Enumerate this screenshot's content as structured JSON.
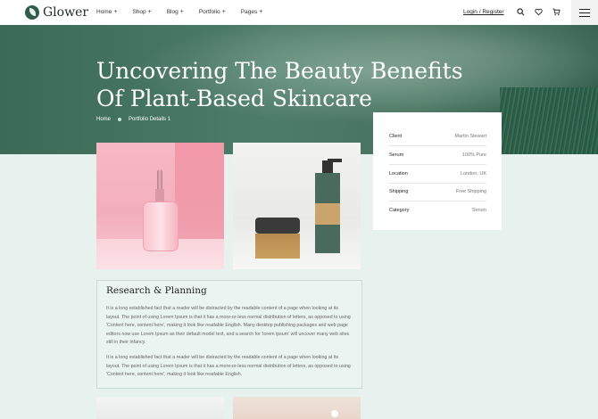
{
  "brand": {
    "name": "Glower"
  },
  "nav": [
    {
      "label": "Home",
      "suffix": "+"
    },
    {
      "label": "Shop",
      "suffix": "+"
    },
    {
      "label": "Blog",
      "suffix": "+"
    },
    {
      "label": "Portfolio",
      "suffix": "+"
    },
    {
      "label": "Pages",
      "suffix": "+"
    }
  ],
  "header": {
    "login": "Login / Register",
    "icons": [
      "search-icon",
      "heart-icon",
      "cart-icon",
      "menu-icon"
    ]
  },
  "hero": {
    "title_line1": "Uncovering The Beauty Benefits",
    "title_line2": "Of Plant-Based Skincare",
    "breadcrumb_home": "Home",
    "breadcrumb_current": "Portfolio Details 1"
  },
  "info": [
    {
      "key": "Client",
      "value": "Martin Stewart"
    },
    {
      "key": "Serum",
      "value": "100% Pure"
    },
    {
      "key": "Location",
      "value": "London, UK"
    },
    {
      "key": "Shipping",
      "value": "Free Shipping"
    },
    {
      "key": "Category",
      "value": "Serum"
    }
  ],
  "research": {
    "title": "Research & Planning",
    "para1": "It is a long established fact that a reader will be distracted by the readable content of a page when looking at its layout. The point of using Lorem Ipsum is that it has a more-or-less normal distribution of letters, as opposed to using 'Content here, content here', making it look like readable English. Many desktop publishing packages and web page editors now use Lorem Ipsum as their default model text, and a search for 'lorem ipsum' will uncover many web sites still in their infancy.",
    "para2": "It is a long established fact that a reader will be distracted by the readable content of a page when looking at its layout. The point of using Lorem Ipsum is that it has a more-or-less normal distribution of letters, as opposed to using 'Content here, content here', making it look like readable English."
  },
  "colors": {
    "accent": "#2f5d4a",
    "hero": "#3f6e5a",
    "background": "#e7f2ee"
  }
}
